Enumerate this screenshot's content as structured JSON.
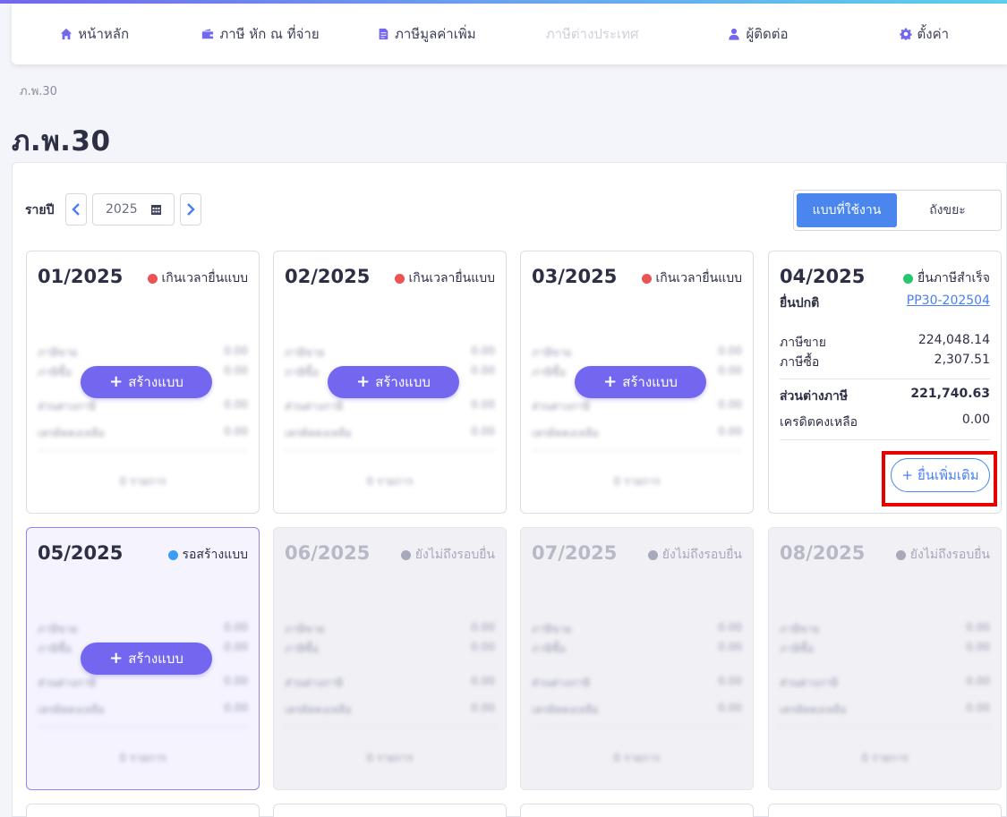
{
  "nav": {
    "items": [
      {
        "label": "หน้าหลัก",
        "icon": "home-icon"
      },
      {
        "label": "ภาษี หัก ณ ที่จ่าย",
        "icon": "wallet-icon"
      },
      {
        "label": "ภาษีมูลค่าเพิ่ม",
        "icon": "document-icon"
      },
      {
        "label": "ภาษีต่างประเทศ",
        "icon": "",
        "disabled": true
      },
      {
        "label": "ผู้ติดต่อ",
        "icon": "user-icon"
      },
      {
        "label": "ตั้งค่า",
        "icon": "gear-icon"
      }
    ]
  },
  "breadcrumb": "ภ.พ.30",
  "page_title": "ภ.พ.30",
  "filter": {
    "year_label": "รายปี",
    "year": "2025",
    "segments": {
      "active": "แบบที่ใช้งาน",
      "inactive": "ถังขยะ"
    }
  },
  "colors": {
    "accent": "#7367f0",
    "overdue": "#ea5455",
    "success": "#28c76f",
    "pending": "#3b9cf5",
    "future": "#a7a8b8"
  },
  "card_labels": {
    "create": "สร้างแบบ",
    "file_more": "ยื่นเพิ่มเติม",
    "sales_tax": "ภาษีขาย",
    "purchase_tax": "ภาษีซื้อ",
    "tax_difference": "ส่วนต่างภาษี",
    "credit_remaining": "เครดิตคงเหลือ",
    "zero": "0.00",
    "zero_items": "0 รายการ"
  },
  "cards": [
    {
      "period": "01/2025",
      "status": "เกินเวลายื่นแบบ",
      "state": "overdue"
    },
    {
      "period": "02/2025",
      "status": "เกินเวลายื่นแบบ",
      "state": "overdue"
    },
    {
      "period": "03/2025",
      "status": "เกินเวลายื่นแบบ",
      "state": "overdue"
    },
    {
      "period": "04/2025",
      "status": "ยื่นภาษีสำเร็จ",
      "state": "filed",
      "filing_type": "ยื่นปกติ",
      "reference": "PP30-202504",
      "sales_tax": "224,048.14",
      "purchase_tax": "2,307.51",
      "tax_difference": "221,740.63",
      "credit_remaining": "0.00"
    },
    {
      "period": "05/2025",
      "status": "รอสร้างแบบ",
      "state": "pending"
    },
    {
      "period": "06/2025",
      "status": "ยังไม่ถึงรอบยื่น",
      "state": "future"
    },
    {
      "period": "07/2025",
      "status": "ยังไม่ถึงรอบยื่น",
      "state": "future"
    },
    {
      "period": "08/2025",
      "status": "ยังไม่ถึงรอบยื่น",
      "state": "future"
    }
  ]
}
